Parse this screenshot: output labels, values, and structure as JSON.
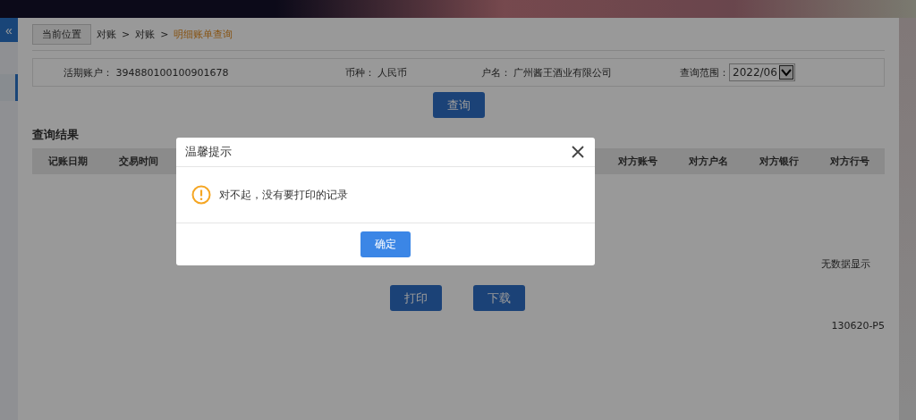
{
  "sidebar": {
    "collapse_icon": "«"
  },
  "breadcrumb": {
    "label": "当前位置",
    "items": [
      "对账",
      ">",
      "对账",
      ">"
    ],
    "current": "明细账单查询"
  },
  "account_bar": {
    "fields": [
      {
        "label": "活期账户：",
        "value": "394880100100901678"
      },
      {
        "label": "币种：",
        "value": "人民币"
      },
      {
        "label": "户名：",
        "value": "广州酱王酒业有限公司"
      }
    ],
    "range": {
      "label": "查询范围：",
      "value": "2022/06"
    }
  },
  "query_button": "查询",
  "results": {
    "title": "查询结果",
    "columns": [
      "记账日期",
      "交易时间",
      "对方账号",
      "对方户名",
      "对方银行",
      "对方行号"
    ],
    "empty_text": "无数据显示"
  },
  "actions": [
    "打印",
    "下载"
  ],
  "page_code": "130620-P5",
  "dialog": {
    "title": "温馨提示",
    "message": "对不起，没有要打印的记录",
    "ok": "确定"
  }
}
